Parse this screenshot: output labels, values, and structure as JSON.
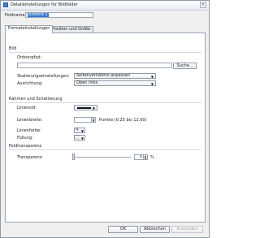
{
  "window": {
    "title": "Detaileinstellungen für Bildfelder",
    "close_glyph": "×"
  },
  "name_field": {
    "label": "Feldname:",
    "value": "Bildfeld 1"
  },
  "tabs": [
    {
      "label": "Formateinstellungen"
    },
    {
      "label": "Position und Größe"
    }
  ],
  "image_section": {
    "title": "Bild",
    "folder_label": "Ordnerpfad:",
    "folder_value": "",
    "browse_label": "Suche...",
    "scaling_label": "Skalierungseinstellungen:",
    "scaling_value": "Seitenverhältnis anpassen",
    "alignment_label": "Ausrichtung:",
    "alignment_value": "Oben links"
  },
  "frame_section": {
    "title": "Rahmen und Schattierung",
    "line_style_label": "Linienstil:",
    "line_width_label": "Linienbreite:",
    "line_width_value": "",
    "line_width_hint": "Punkte (0.25 bis 12.00)",
    "line_color_label": "Linienfarbe:",
    "fill_label": "Füllung:"
  },
  "transparency_section": {
    "title": "Feldtransparenz",
    "label": "Transparenz:",
    "value": "0",
    "unit": "%",
    "level": 0
  },
  "buttons": {
    "ok": "OK",
    "cancel": "Abbrechen",
    "apply": "Anwenden"
  }
}
